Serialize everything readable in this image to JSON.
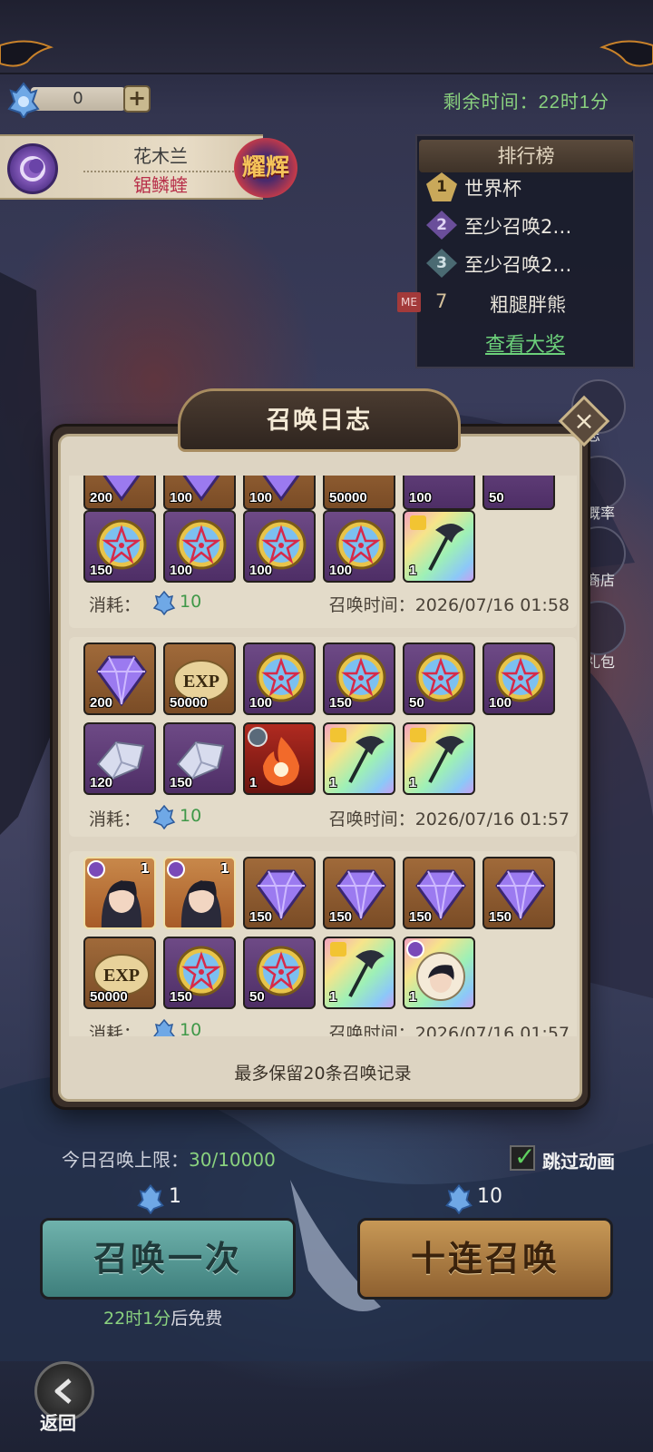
{
  "header": {
    "currency_value": "0",
    "currency_plus": "+",
    "remaining_time": "剩余时间：22时1分"
  },
  "hero": {
    "name": "花木兰",
    "subtitle": "锯鳞蝰",
    "badge": "耀辉"
  },
  "ranking": {
    "title": "排行榜",
    "items": [
      {
        "rank": "1",
        "label": "世界杯"
      },
      {
        "rank": "2",
        "label": "至少召唤2…"
      },
      {
        "rank": "3",
        "label": "至少召唤2…"
      }
    ],
    "me_tag": "ME",
    "me_rank": "7",
    "me_name": "粗腿胖熊",
    "view_prize": "查看大奖"
  },
  "side_menu": {
    "labels": [
      "志",
      "概率",
      "商店",
      "礼包"
    ]
  },
  "modal": {
    "title": "召唤日志",
    "close": "×",
    "note": "最多保留20条召唤记录",
    "cost_label": "消耗：",
    "time_label": "召唤时间：",
    "records": [
      {
        "row1": [
          "200",
          "100",
          "100",
          "50000",
          "100",
          "50"
        ],
        "row2": [
          "150",
          "100",
          "100",
          "100",
          "1"
        ],
        "cost": "10",
        "time": "2026/07/16 01:58"
      },
      {
        "row1": [
          "200",
          "50000",
          "100",
          "150",
          "50",
          "100"
        ],
        "row2": [
          "120",
          "150",
          "1",
          "1",
          "1"
        ],
        "cost": "10",
        "time": "2026/07/16 01:57"
      },
      {
        "row1": [
          "1",
          "1",
          "150",
          "150",
          "150",
          "150"
        ],
        "row2": [
          "50000",
          "150",
          "50",
          "1",
          "1"
        ],
        "cost": "10",
        "time": "2026/07/16 01:57"
      }
    ],
    "exp_text": "EXP"
  },
  "bottom": {
    "limit_label": "今日召唤上限：",
    "limit_value": "30/10000",
    "skip_label": "跳过动画",
    "skip_checked": true,
    "cost_one": "1",
    "cost_ten": "10",
    "summon_one": "召唤一次",
    "summon_ten": "十连召唤",
    "free_time": "22时1分",
    "free_suffix": "后免费",
    "back": "返回"
  },
  "colors": {
    "green_text": "#8ad27f",
    "cost_green": "#3f9848",
    "modal_bg": "#ddd4c2"
  }
}
